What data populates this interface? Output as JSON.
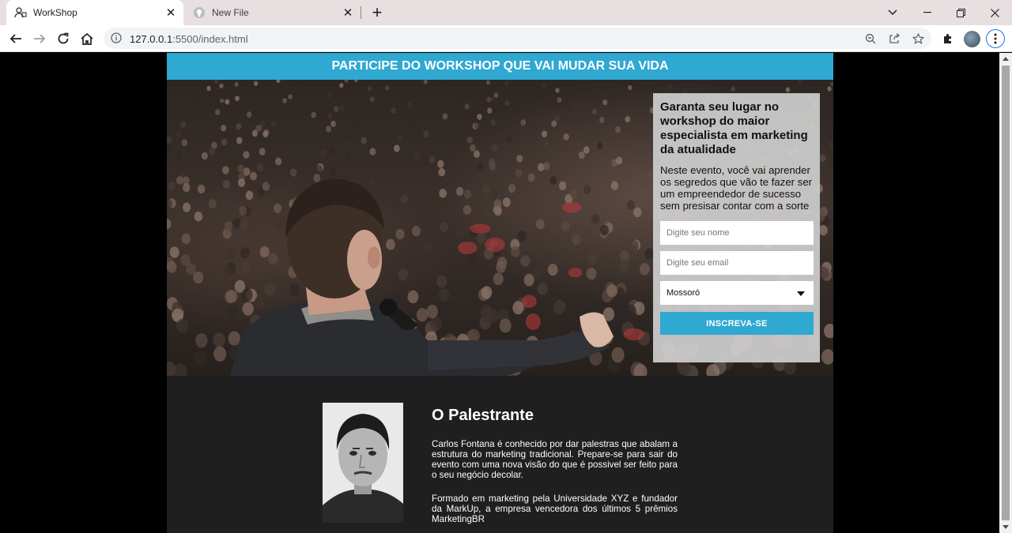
{
  "browser": {
    "tabs": [
      {
        "title": "WorkShop",
        "icon": "workshop-favicon",
        "active": true
      },
      {
        "title": "New File",
        "icon": "github-icon",
        "active": false
      }
    ],
    "url_host": "127.0.0.1",
    "url_path": ":5500/index.html"
  },
  "page": {
    "banner": "PARTICIPE DO WORKSHOP QUE VAI MUDAR SUA VIDA",
    "form": {
      "heading": "Garanta seu lugar no workshop do maior especialista em marketing da atualidade",
      "description": "Neste evento, você vai aprender os segredos que vão te fazer ser um empreendedor de sucesso sem presisar contar com a sorte",
      "name_placeholder": "Digite seu nome",
      "email_placeholder": "Digite seu email",
      "city_selected": "Mossoró",
      "submit_label": "INSCREVA-SE"
    },
    "speaker": {
      "title": "O Palestrante",
      "bio_1": "Carlos Fontana é conhecido por dar palestras que abalam a estrutura do marketing tradicional. Prepare-se para sair do evento com uma nova visão do que é possivel ser feito para o seu negócio decolar.",
      "bio_2": "Formado em marketing pela Universidade XYZ e fundador da MarkUp, a empresa vencedora dos últimos 5 prêmios MarketingBR"
    }
  },
  "colors": {
    "accent": "#2fa8d2",
    "page_bg": "#1f1f1f",
    "card_bg": "#cdcdcd"
  }
}
